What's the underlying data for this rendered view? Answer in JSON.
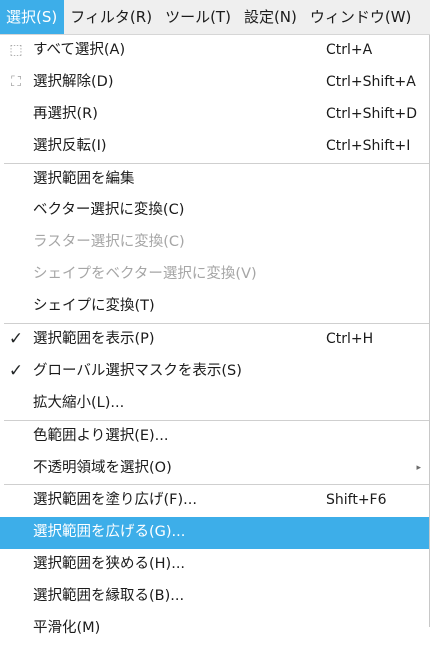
{
  "menubar": {
    "items": [
      {
        "label": "選択(S)",
        "active": true
      },
      {
        "label": "フィルタ(R)",
        "active": false
      },
      {
        "label": "ツール(T)",
        "active": false
      },
      {
        "label": "設定(N)",
        "active": false
      },
      {
        "label": "ウィンドウ(W)",
        "active": false
      }
    ]
  },
  "menu": {
    "groups": [
      [
        {
          "label": "すべて選択(A)",
          "shortcut": "Ctrl+A",
          "icon": "select-all-icon"
        },
        {
          "label": "選択解除(D)",
          "shortcut": "Ctrl+Shift+A",
          "icon": "deselect-icon"
        },
        {
          "label": "再選択(R)",
          "shortcut": "Ctrl+Shift+D"
        },
        {
          "label": "選択反転(I)",
          "shortcut": "Ctrl+Shift+I"
        }
      ],
      [
        {
          "label": "選択範囲を編集"
        },
        {
          "label": "ベクター選択に変換(C)"
        },
        {
          "label": "ラスター選択に変換(C)",
          "disabled": true
        },
        {
          "label": "シェイプをベクター選択に変換(V)",
          "disabled": true
        },
        {
          "label": "シェイプに変換(T)"
        }
      ],
      [
        {
          "label": "選択範囲を表示(P)",
          "shortcut": "Ctrl+H",
          "checked": true
        },
        {
          "label": "グローバル選択マスクを表示(S)",
          "checked": true
        },
        {
          "label": "拡大縮小(L)..."
        }
      ],
      [
        {
          "label": "色範囲より選択(E)..."
        },
        {
          "label": "不透明領域を選択(O)",
          "submenu": true
        }
      ],
      [
        {
          "label": "選択範囲を塗り広げ(F)...",
          "shortcut": "Shift+F6"
        },
        {
          "label": "選択範囲を広げる(G)...",
          "highlighted": true
        },
        {
          "label": "選択範囲を狭める(H)..."
        },
        {
          "label": "選択範囲を縁取る(B)..."
        },
        {
          "label": "平滑化(M)"
        }
      ]
    ]
  },
  "colors": {
    "accent": "#3daee9",
    "disabled_text": "#a6a6a6",
    "menubar_bg": "#efefef"
  }
}
